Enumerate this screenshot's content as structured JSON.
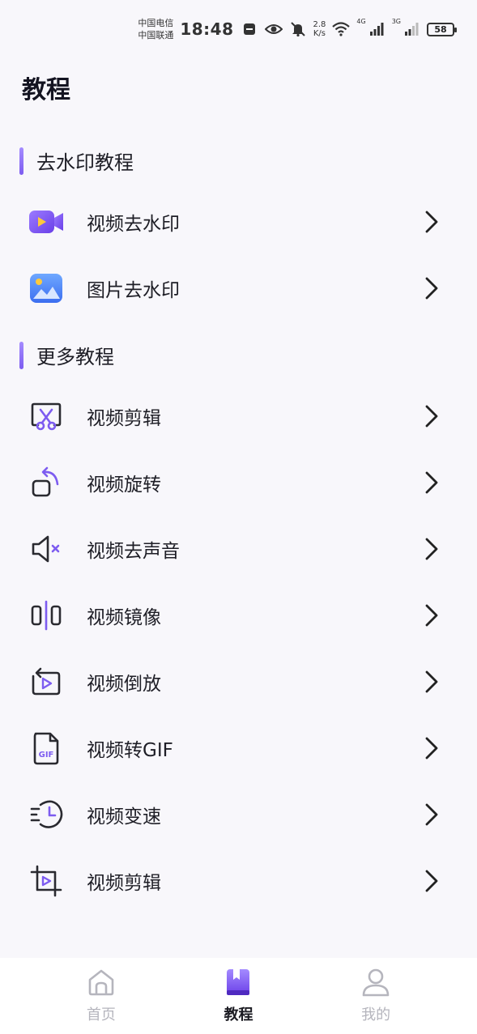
{
  "status_bar": {
    "carrier_1": "中国电信",
    "carrier_2": "中国联通",
    "time": "18:48",
    "speed_value": "2.8",
    "speed_unit": "K/s",
    "network_1": "4G",
    "network_2": "3G",
    "battery": "58"
  },
  "page": {
    "title": "教程"
  },
  "sections": [
    {
      "title": "去水印教程",
      "items": [
        {
          "label": "视频去水印",
          "icon": "video-camera-icon"
        },
        {
          "label": "图片去水印",
          "icon": "image-icon"
        }
      ]
    },
    {
      "title": "更多教程",
      "items": [
        {
          "label": "视频剪辑",
          "icon": "scissors-icon"
        },
        {
          "label": "视频旋转",
          "icon": "rotate-icon"
        },
        {
          "label": "视频去声音",
          "icon": "mute-icon"
        },
        {
          "label": "视频镜像",
          "icon": "mirror-icon"
        },
        {
          "label": "视频倒放",
          "icon": "reverse-play-icon"
        },
        {
          "label": "视频转GIF",
          "icon": "gif-file-icon"
        },
        {
          "label": "视频变速",
          "icon": "speed-clock-icon"
        },
        {
          "label": "视频剪辑",
          "icon": "crop-icon"
        }
      ]
    }
  ],
  "tab_bar": {
    "tabs": [
      {
        "label": "首页",
        "icon": "home-icon",
        "active": false
      },
      {
        "label": "教程",
        "icon": "book-icon",
        "active": true
      },
      {
        "label": "我的",
        "icon": "user-icon",
        "active": false
      }
    ]
  },
  "colors": {
    "accent": "#7d5cf0",
    "background": "#f8f7fb",
    "text": "#1e1e26",
    "inactive_tab": "#b5b5bd"
  }
}
